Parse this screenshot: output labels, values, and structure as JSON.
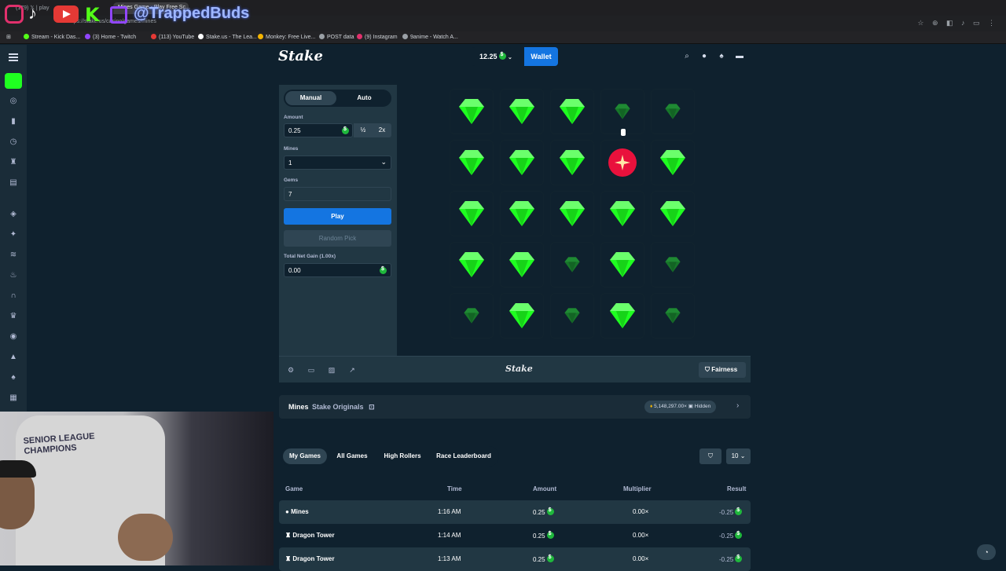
{
  "browser": {
    "tabs": [
      {
        "label": "(179) 𝕏 | play"
      },
      {
        "label": "Mines Game - Play Free Sc..."
      }
    ],
    "url": "https://stake.us/casino/games/mines",
    "bookmarks": [
      {
        "label": "Stream - Kick Das...",
        "color": "#53fc18"
      },
      {
        "label": "(3) Home - Twitch",
        "color": "#9146ff"
      },
      {
        "label": "(113) YouTube",
        "color": "#e53935"
      },
      {
        "label": "Stake.us - The Lea...",
        "color": "#ffffff"
      },
      {
        "label": "Monkey: Free Live...",
        "color": "#f4b400"
      },
      {
        "label": "POST data",
        "color": "#9aa0a6"
      },
      {
        "label": "(9) Instagram",
        "color": "#e1306c"
      },
      {
        "label": "9anime - Watch A...",
        "color": "#9aa0a6"
      }
    ]
  },
  "overlay": {
    "handle": "@TrappedBuds"
  },
  "header": {
    "logo": "Stake",
    "balance": "12.25",
    "wallet_label": "Wallet"
  },
  "controls": {
    "tabs": {
      "manual": "Manual",
      "auto": "Auto"
    },
    "amount_label": "Amount",
    "amount_value": "0.25",
    "half_label": "½",
    "double_label": "2x",
    "mines_label": "Mines",
    "mines_value": "1",
    "gems_label": "Gems",
    "gems_value": "7",
    "play_label": "Play",
    "random_label": "Random Pick",
    "net_gain_label": "Total Net Gain (1.00x)",
    "net_gain_value": "0.00"
  },
  "board": {
    "rows": [
      [
        "gem",
        "gem",
        "gem",
        "gem-dim",
        "gem-dim"
      ],
      [
        "gem",
        "gem",
        "gem",
        "mine",
        "gem"
      ],
      [
        "gem",
        "gem",
        "gem",
        "gem",
        "gem"
      ],
      [
        "gem",
        "gem",
        "gem-dim",
        "gem",
        "gem-dim"
      ],
      [
        "gem-dim",
        "gem",
        "gem-dim",
        "gem",
        "gem-dim"
      ]
    ],
    "colors": {
      "gem": "#1fff20",
      "gem_dim": "#17752a",
      "mine": "#e9113c"
    }
  },
  "toolbar": {
    "logo": "Stake",
    "fairness_label": "Fairness"
  },
  "info": {
    "title": "Mines",
    "subtitle": "Stake Originals",
    "stat": "5,148,297.00×",
    "stat_label": "Hidden"
  },
  "bets": {
    "tabs": [
      "My Games",
      "All Games",
      "High Rollers",
      "Race Leaderboard"
    ],
    "page_size": "10",
    "columns": [
      "Game",
      "Time",
      "Amount",
      "Multiplier",
      "Result"
    ],
    "rows": [
      {
        "game": "Mines",
        "time": "1:16 AM",
        "amount": "0.25",
        "multiplier": "0.00×",
        "result": "-0.25"
      },
      {
        "game": "Dragon Tower",
        "time": "1:14 AM",
        "amount": "0.25",
        "multiplier": "0.00×",
        "result": "-0.25"
      },
      {
        "game": "Dragon Tower",
        "time": "1:13 AM",
        "amount": "0.25",
        "multiplier": "0.00×",
        "result": "-0.25"
      }
    ]
  },
  "webcam": {
    "shirt_text": "SENIOR LEAGUE CHAMPIONS"
  }
}
